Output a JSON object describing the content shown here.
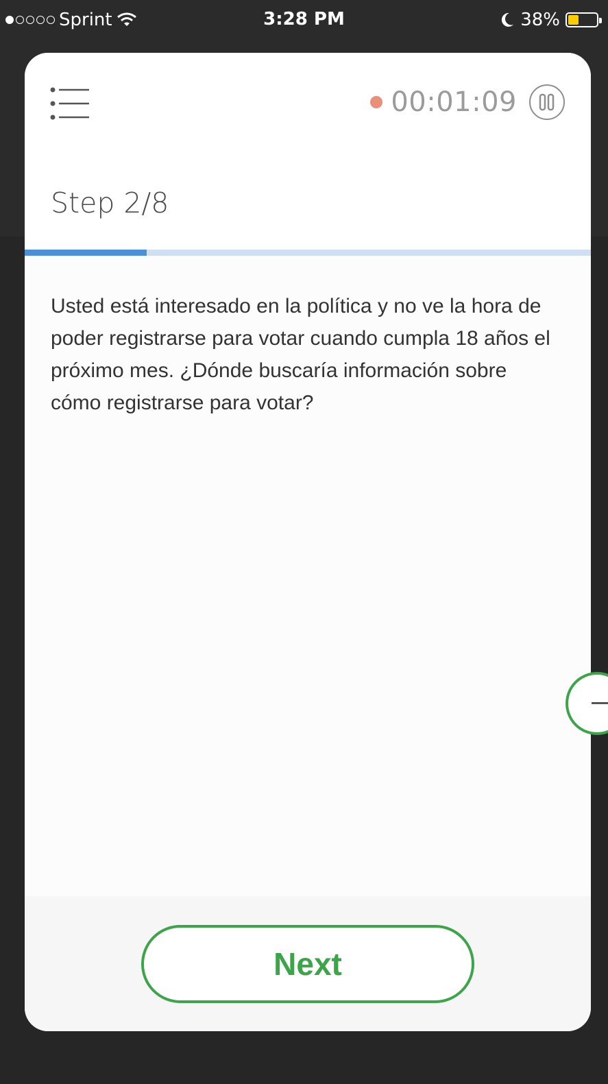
{
  "status_bar": {
    "carrier": "Sprint",
    "time": "3:28 PM",
    "battery_percent": "38%",
    "battery_level": 0.38,
    "signal_bars_filled": 1,
    "signal_bars_total": 5
  },
  "modal": {
    "timer": "00:01:09",
    "step_label": "Step 2/8",
    "progress_fraction": 0.215,
    "question": "Usted está interesado en la política y no ve la hora de poder registrarse para votar cuando cumpla 18 años el próximo mes. ¿Dónde buscaría información sobre cómo registrarse para votar?",
    "next_button_label": "Next"
  },
  "colors": {
    "accent_green": "#3ea44a",
    "progress_blue": "#4a90d9",
    "recording_dot": "#e8907a",
    "battery_yellow": "#ffcc00"
  },
  "icons": {
    "menu": "menu-list-icon",
    "pause": "pause-icon",
    "wifi": "wifi-icon",
    "moon": "moon-icon",
    "battery": "battery-icon"
  }
}
